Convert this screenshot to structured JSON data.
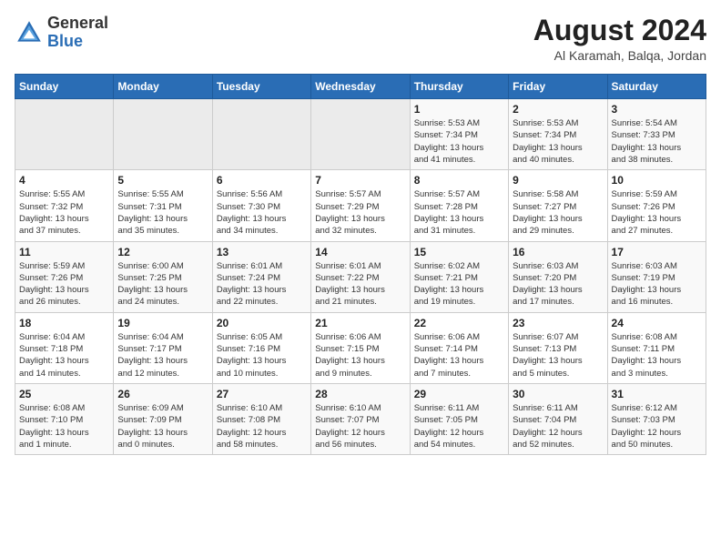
{
  "header": {
    "logo_general": "General",
    "logo_blue": "Blue",
    "main_title": "August 2024",
    "subtitle": "Al Karamah, Balqa, Jordan"
  },
  "calendar": {
    "days_of_week": [
      "Sunday",
      "Monday",
      "Tuesday",
      "Wednesday",
      "Thursday",
      "Friday",
      "Saturday"
    ],
    "weeks": [
      [
        {
          "day": "",
          "info": ""
        },
        {
          "day": "",
          "info": ""
        },
        {
          "day": "",
          "info": ""
        },
        {
          "day": "",
          "info": ""
        },
        {
          "day": "1",
          "info": "Sunrise: 5:53 AM\nSunset: 7:34 PM\nDaylight: 13 hours\nand 41 minutes."
        },
        {
          "day": "2",
          "info": "Sunrise: 5:53 AM\nSunset: 7:34 PM\nDaylight: 13 hours\nand 40 minutes."
        },
        {
          "day": "3",
          "info": "Sunrise: 5:54 AM\nSunset: 7:33 PM\nDaylight: 13 hours\nand 38 minutes."
        }
      ],
      [
        {
          "day": "4",
          "info": "Sunrise: 5:55 AM\nSunset: 7:32 PM\nDaylight: 13 hours\nand 37 minutes."
        },
        {
          "day": "5",
          "info": "Sunrise: 5:55 AM\nSunset: 7:31 PM\nDaylight: 13 hours\nand 35 minutes."
        },
        {
          "day": "6",
          "info": "Sunrise: 5:56 AM\nSunset: 7:30 PM\nDaylight: 13 hours\nand 34 minutes."
        },
        {
          "day": "7",
          "info": "Sunrise: 5:57 AM\nSunset: 7:29 PM\nDaylight: 13 hours\nand 32 minutes."
        },
        {
          "day": "8",
          "info": "Sunrise: 5:57 AM\nSunset: 7:28 PM\nDaylight: 13 hours\nand 31 minutes."
        },
        {
          "day": "9",
          "info": "Sunrise: 5:58 AM\nSunset: 7:27 PM\nDaylight: 13 hours\nand 29 minutes."
        },
        {
          "day": "10",
          "info": "Sunrise: 5:59 AM\nSunset: 7:26 PM\nDaylight: 13 hours\nand 27 minutes."
        }
      ],
      [
        {
          "day": "11",
          "info": "Sunrise: 5:59 AM\nSunset: 7:26 PM\nDaylight: 13 hours\nand 26 minutes."
        },
        {
          "day": "12",
          "info": "Sunrise: 6:00 AM\nSunset: 7:25 PM\nDaylight: 13 hours\nand 24 minutes."
        },
        {
          "day": "13",
          "info": "Sunrise: 6:01 AM\nSunset: 7:24 PM\nDaylight: 13 hours\nand 22 minutes."
        },
        {
          "day": "14",
          "info": "Sunrise: 6:01 AM\nSunset: 7:22 PM\nDaylight: 13 hours\nand 21 minutes."
        },
        {
          "day": "15",
          "info": "Sunrise: 6:02 AM\nSunset: 7:21 PM\nDaylight: 13 hours\nand 19 minutes."
        },
        {
          "day": "16",
          "info": "Sunrise: 6:03 AM\nSunset: 7:20 PM\nDaylight: 13 hours\nand 17 minutes."
        },
        {
          "day": "17",
          "info": "Sunrise: 6:03 AM\nSunset: 7:19 PM\nDaylight: 13 hours\nand 16 minutes."
        }
      ],
      [
        {
          "day": "18",
          "info": "Sunrise: 6:04 AM\nSunset: 7:18 PM\nDaylight: 13 hours\nand 14 minutes."
        },
        {
          "day": "19",
          "info": "Sunrise: 6:04 AM\nSunset: 7:17 PM\nDaylight: 13 hours\nand 12 minutes."
        },
        {
          "day": "20",
          "info": "Sunrise: 6:05 AM\nSunset: 7:16 PM\nDaylight: 13 hours\nand 10 minutes."
        },
        {
          "day": "21",
          "info": "Sunrise: 6:06 AM\nSunset: 7:15 PM\nDaylight: 13 hours\nand 9 minutes."
        },
        {
          "day": "22",
          "info": "Sunrise: 6:06 AM\nSunset: 7:14 PM\nDaylight: 13 hours\nand 7 minutes."
        },
        {
          "day": "23",
          "info": "Sunrise: 6:07 AM\nSunset: 7:13 PM\nDaylight: 13 hours\nand 5 minutes."
        },
        {
          "day": "24",
          "info": "Sunrise: 6:08 AM\nSunset: 7:11 PM\nDaylight: 13 hours\nand 3 minutes."
        }
      ],
      [
        {
          "day": "25",
          "info": "Sunrise: 6:08 AM\nSunset: 7:10 PM\nDaylight: 13 hours\nand 1 minute."
        },
        {
          "day": "26",
          "info": "Sunrise: 6:09 AM\nSunset: 7:09 PM\nDaylight: 13 hours\nand 0 minutes."
        },
        {
          "day": "27",
          "info": "Sunrise: 6:10 AM\nSunset: 7:08 PM\nDaylight: 12 hours\nand 58 minutes."
        },
        {
          "day": "28",
          "info": "Sunrise: 6:10 AM\nSunset: 7:07 PM\nDaylight: 12 hours\nand 56 minutes."
        },
        {
          "day": "29",
          "info": "Sunrise: 6:11 AM\nSunset: 7:05 PM\nDaylight: 12 hours\nand 54 minutes."
        },
        {
          "day": "30",
          "info": "Sunrise: 6:11 AM\nSunset: 7:04 PM\nDaylight: 12 hours\nand 52 minutes."
        },
        {
          "day": "31",
          "info": "Sunrise: 6:12 AM\nSunset: 7:03 PM\nDaylight: 12 hours\nand 50 minutes."
        }
      ]
    ]
  }
}
